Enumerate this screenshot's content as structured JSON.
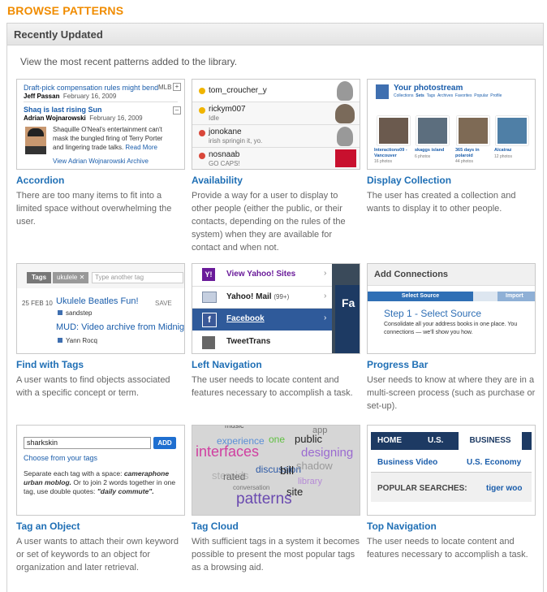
{
  "page": {
    "heading": "BROWSE PATTERNS",
    "section_title": "Recently Updated",
    "intro": "View the most recent patterns added to the library."
  },
  "cards": [
    {
      "title": "Accordion",
      "desc": "There are too many items to fit into a limited space without overwhelming the user."
    },
    {
      "title": "Availability",
      "desc": "Provide a way for a user to display to other people (either the public, or their contacts, depending on the rules of the system) when they are available for contact and when not."
    },
    {
      "title": "Display Collection",
      "desc": "The user has created a collection and wants to display it to other people."
    },
    {
      "title": "Find with Tags",
      "desc": "A user wants to find objects associated with a specific concept or term."
    },
    {
      "title": "Left Navigation",
      "desc": "The user needs to locate content and features necessary to accomplish a task."
    },
    {
      "title": "Progress Bar",
      "desc": "User needs to know at where they are in a multi-screen process (such as purchase or set-up)."
    },
    {
      "title": "Tag an Object",
      "desc": "A user wants to attach their own keyword or set of keywords to an object for organization and later retrieval."
    },
    {
      "title": "Tag Cloud",
      "desc": "With sufficient tags in a system it becomes possible to present the most popular tags as a browsing aid."
    },
    {
      "title": "Top Navigation",
      "desc": "The user needs to locate content and features necessary to accomplish a task."
    }
  ],
  "accordion_thumb": {
    "item1": "Draft-pick compensation rules might bend",
    "item1_tag": "MLB",
    "item1_author": "Jeff Passan",
    "item1_date": "February 16, 2009",
    "item2": "Shaq is last rising Sun",
    "item2_author": "Adrian Wojnarowski",
    "item2_date": "February 16, 2009",
    "body": "Shaquille O'Neal's entertainment can't mask the bungled firing of Terry Porter and lingering trade talks.",
    "read_more": "Read More",
    "archive": "View Adrian Wojnarowski Archive"
  },
  "availability_thumb": {
    "users": [
      {
        "name": "tom_croucher_y",
        "status": "",
        "color": "#f0b400"
      },
      {
        "name": "rickym007",
        "status": "Idle",
        "color": "#f0b400"
      },
      {
        "name": "jonokane",
        "status": "irish springin it, yo.",
        "color": "#d9473a"
      },
      {
        "name": "nosnaab",
        "status": "GO CAPS!",
        "color": "#d9473a"
      }
    ]
  },
  "collection_thumb": {
    "title": "Your photostream",
    "nav": [
      "Collections",
      "Sets",
      "Tags",
      "Archives",
      "Favorites",
      "Popular",
      "Profile"
    ],
    "photos": [
      {
        "title": "Interactions09 - Vancouver",
        "count": "16 photos",
        "color": "#6b5a4e"
      },
      {
        "title": "skaggs island",
        "count": "6 photos",
        "color": "#5c6e7e"
      },
      {
        "title": "365 days in polaroid",
        "count": "44 photos",
        "color": "#7e6a55"
      },
      {
        "title": "Alcatraz",
        "count": "12 photos",
        "color": "#4f7fa6"
      }
    ]
  },
  "tags_thumb": {
    "label": "Tags",
    "tag": "ukulele",
    "placeholder": "Type another tag",
    "date": "25 FEB 10",
    "item1": "Ukulele Beatles Fun!",
    "save": "SAVE",
    "user1": "sandstep",
    "item2": "MUD: Video archive from Midnig",
    "user2": "Yann Rocq"
  },
  "leftnav_thumb": {
    "items": [
      "View Yahoo! Sites",
      "Yahoo! Mail",
      "Facebook",
      "TweetTrans"
    ],
    "mail_count": "(99+)",
    "side_text": "Fa"
  },
  "progress_thumb": {
    "title": "Add Connections",
    "step_active": "Select Source",
    "step_next": "Import",
    "heading": "Step 1 - Select Source",
    "body": "Consolidate all your address books in one place. You connections — we'll show you how."
  },
  "tagobj_thumb": {
    "value": "sharkskin",
    "add": "ADD",
    "choose": "Choose from your tags",
    "help1": "Separate each tag with a space:",
    "help_example": "cameraphone urban moblog.",
    "help2": "Or to join 2 words together in one tag, use double quotes:",
    "help_quote": "\"daily commute\"."
  },
  "cloud_thumb": {
    "words": [
      "music",
      "experience",
      "one",
      "public",
      "app",
      "interfaces",
      "designing",
      "discussion",
      "bill",
      "shadow",
      "steroids",
      "rated",
      "library",
      "conversation",
      "site",
      "patterns"
    ]
  },
  "topnav_thumb": {
    "tabs": [
      "HOME",
      "U.S.",
      "BUSINESS"
    ],
    "sub": [
      "Business Video",
      "U.S. Economy"
    ],
    "popular_label": "POPULAR SEARCHES:",
    "popular_value": "tiger woo"
  }
}
